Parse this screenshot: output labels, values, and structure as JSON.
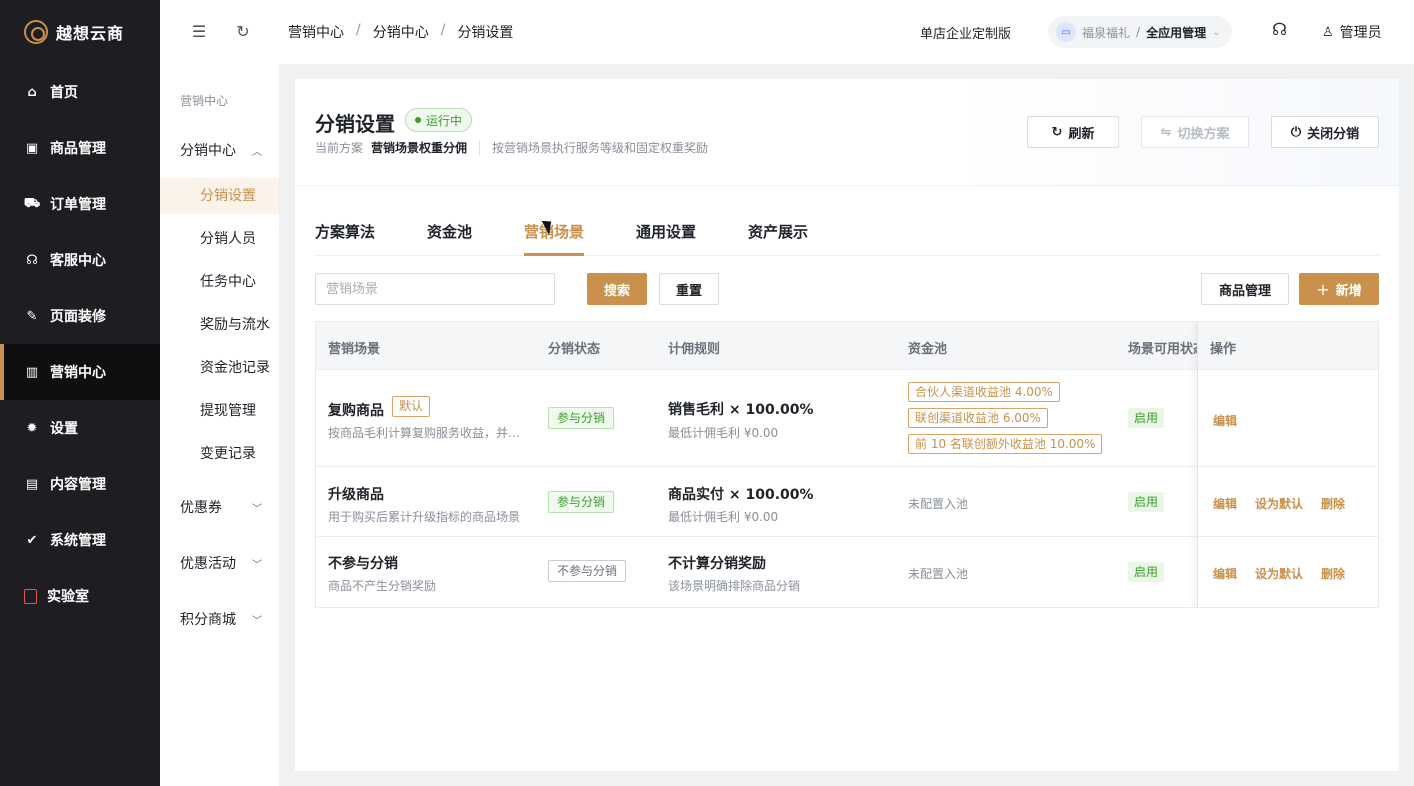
{
  "brand": {
    "name": "越想云商"
  },
  "sidebar": {
    "items": [
      {
        "label": "首页",
        "icon": "home-icon"
      },
      {
        "label": "商品管理",
        "icon": "bag-icon"
      },
      {
        "label": "订单管理",
        "icon": "cart-icon"
      },
      {
        "label": "客服中心",
        "icon": "headset-icon"
      },
      {
        "label": "页面装修",
        "icon": "brush-icon"
      },
      {
        "label": "营销中心",
        "icon": "shop-icon",
        "active": true
      },
      {
        "label": "设置",
        "icon": "gear-icon"
      },
      {
        "label": "内容管理",
        "icon": "content-icon"
      },
      {
        "label": "系统管理",
        "icon": "shield-icon"
      },
      {
        "label": "实验室",
        "icon": "lab-icon"
      }
    ]
  },
  "header": {
    "breadcrumb": [
      "营销中心",
      "分销中心",
      "分销设置"
    ],
    "separator": "/",
    "edition": "单店企业定制版",
    "org_name": "福泉福礼",
    "org_sep": "/",
    "org_app": "全应用管理",
    "user": "管理员"
  },
  "subnav": {
    "title": "营销中心",
    "groups": [
      {
        "label": "分销中心"
      },
      {
        "label": "优惠券"
      },
      {
        "label": "优惠活动"
      },
      {
        "label": "积分商城"
      }
    ],
    "items": [
      {
        "label": "分销设置"
      },
      {
        "label": "分销人员"
      },
      {
        "label": "任务中心"
      },
      {
        "label": "奖励与流水"
      },
      {
        "label": "资金池记录"
      },
      {
        "label": "提现管理"
      },
      {
        "label": "变更记录"
      }
    ]
  },
  "page": {
    "title": "分销设置",
    "status": "运行中",
    "plan_label": "当前方案",
    "plan_name": "营销场景权重分佣",
    "plan_desc": "按营销场景执行服务等级和固定权重奖励",
    "refresh": "刷新",
    "switch_plan": "切换方案",
    "close": "关闭分销"
  },
  "tabs": [
    "方案算法",
    "资金池",
    "营销场景",
    "通用设置",
    "资产展示"
  ],
  "toolbar": {
    "search_placeholder": "营销场景",
    "search": "搜索",
    "reset": "重置",
    "goods": "商品管理",
    "add": "新增"
  },
  "table": {
    "columns": [
      "营销场景",
      "分销状态",
      "计佣规则",
      "资金池",
      "场景可用状态",
      "操作"
    ],
    "rows": [
      {
        "name": "复购商品",
        "badge": "默认",
        "desc": "按商品毛利计算复购服务收益，并…",
        "status": "参与分销",
        "rule": "销售毛利 × 100.00%",
        "rule_sub": "最低计佣毛利 ¥0.00",
        "pools": [
          "合伙人渠道收益池 4.00%",
          "联创渠道收益池 6.00%",
          "前 10 名联创额外收益池 10.00%"
        ],
        "available": "启用",
        "actions": [
          "编辑"
        ]
      },
      {
        "name": "升级商品",
        "desc": "用于购买后累计升级指标的商品场景",
        "status": "参与分销",
        "rule": "商品实付 × 100.00%",
        "rule_sub": "最低计佣毛利 ¥0.00",
        "pool_text": "未配置入池",
        "available": "启用",
        "actions": [
          "编辑",
          "设为默认",
          "删除"
        ]
      },
      {
        "name": "不参与分销",
        "desc": "商品不产生分销奖励",
        "status": "不参与分销",
        "rule": "不计算分销奖励",
        "rule_sub": "该场景明确排除商品分销",
        "pool_text": "未配置入池",
        "available": "启用",
        "actions": [
          "编辑",
          "设为默认",
          "删除"
        ]
      }
    ]
  },
  "colors": {
    "accent": "#c9914c",
    "sidebar": "#1e1e22",
    "success": "#3e9b2f"
  }
}
